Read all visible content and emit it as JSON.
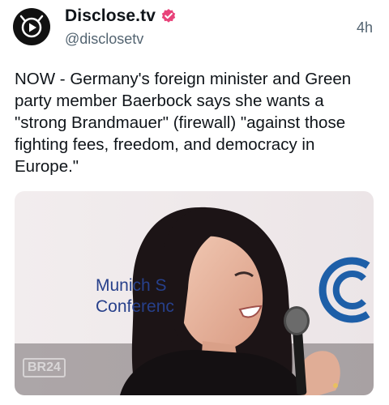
{
  "post": {
    "display_name": "Disclose.tv",
    "handle": "@disclosetv",
    "timestamp": "4h",
    "text": "NOW - Germany's foreign minister and Green party member Baerbock says she wants a \"strong Brandmauer\" (firewall) \"against those fighting fees, freedom, and democracy in Europe.\""
  },
  "media": {
    "banner_line1": "Munich S",
    "banner_line2": "Conferenc",
    "watermark": "BR24"
  },
  "colors": {
    "verified": "#e8437a",
    "banner_text": "#27408b",
    "logo": "#1e5fa8"
  },
  "icons": {
    "avatar": "play-icon",
    "verified": "verified-badge-icon"
  }
}
